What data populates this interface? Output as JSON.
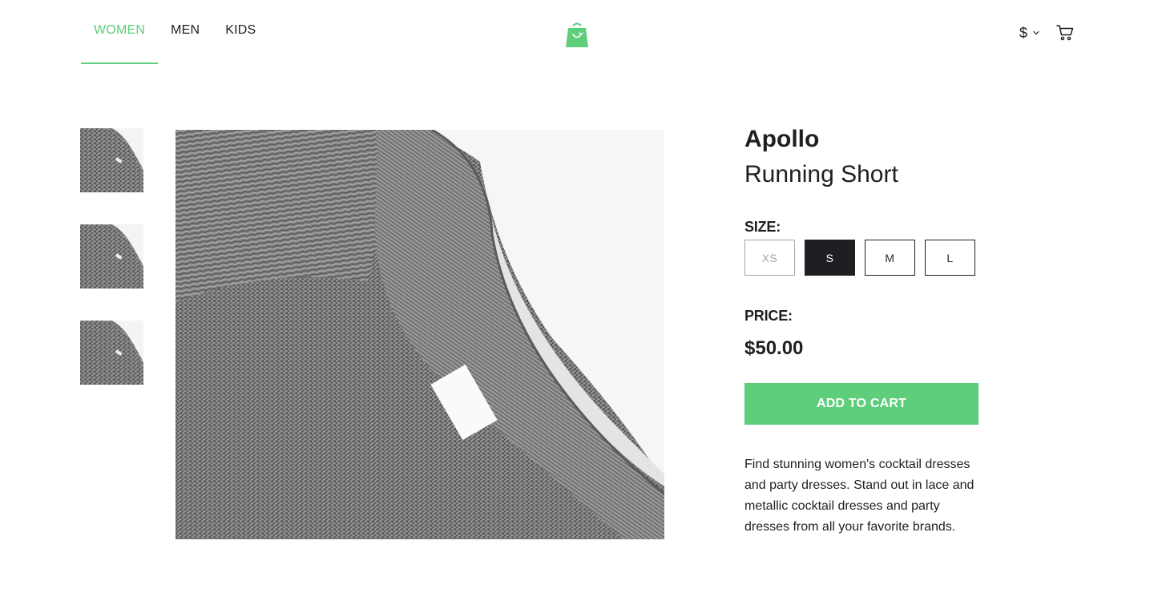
{
  "header": {
    "nav": [
      {
        "label": "WOMEN",
        "active": true
      },
      {
        "label": "MEN",
        "active": false
      },
      {
        "label": "KIDS",
        "active": false
      }
    ],
    "logo_icon": "shopping-bag-icon",
    "currency_symbol": "$",
    "cart_icon": "cart-icon",
    "accent_color": "#5ece7b"
  },
  "gallery": {
    "thumbnail_icon": "sweater-image",
    "thumbnail_count": 3
  },
  "product": {
    "brand": "Apollo",
    "name": "Running Short",
    "size_label": "SIZE:",
    "sizes": [
      {
        "label": "XS",
        "state": "disabled"
      },
      {
        "label": "S",
        "state": "selected"
      },
      {
        "label": "M",
        "state": "available"
      },
      {
        "label": "L",
        "state": "available"
      }
    ],
    "price_label": "PRICE:",
    "price": "$50.00",
    "add_to_cart_label": "ADD TO CART",
    "description": "Find stunning women's cocktail dresses and party dresses. Stand out in lace and metallic cocktail dresses and party dresses from all your favorite brands."
  }
}
